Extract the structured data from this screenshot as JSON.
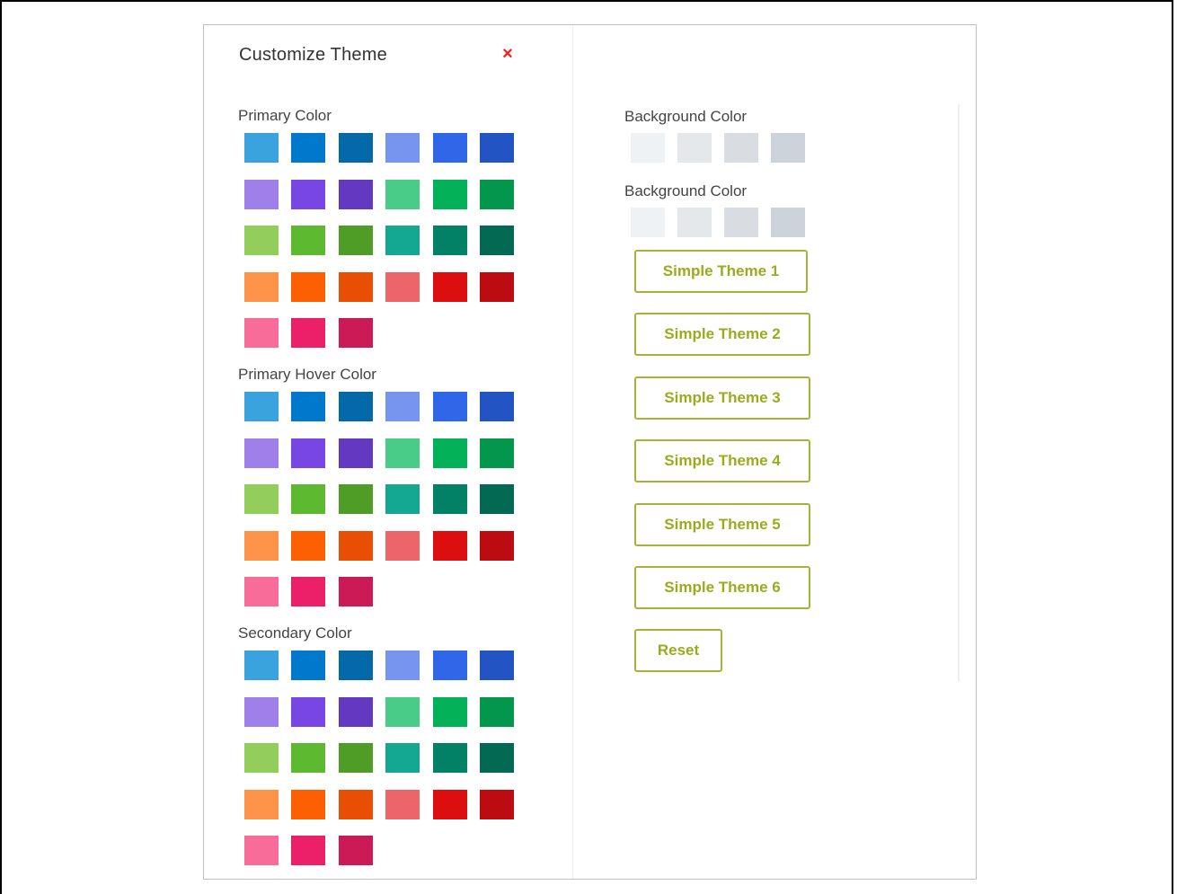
{
  "panel": {
    "title": "Customize Theme",
    "close_symbol": "×"
  },
  "palette": [
    "#3aa2dc",
    "#0078cc",
    "#0369a9",
    "#7695ef",
    "#2f67e8",
    "#2354c4",
    "#9f7fea",
    "#7847e3",
    "#6439c2",
    "#49cc88",
    "#03b158",
    "#02974c",
    "#93ce5d",
    "#5cb930",
    "#4f9d27",
    "#14a890",
    "#028166",
    "#026a53",
    "#fe944a",
    "#fc6003",
    "#e94f04",
    "#ec6669",
    "#dd0e10",
    "#bd0c11",
    "#f76c98",
    "#ec1f69",
    "#cc1a56"
  ],
  "sections": [
    {
      "label": "Primary Color"
    },
    {
      "label": "Primary Hover Color"
    },
    {
      "label": "Secondary Color"
    }
  ],
  "background": {
    "groups": [
      {
        "label": "Background Color"
      },
      {
        "label": "Background Color"
      }
    ],
    "colors": [
      "#eff2f5",
      "#e5e8eb",
      "#d9dde1",
      "#ccd3da"
    ]
  },
  "theme_buttons": [
    "Simple Theme 1",
    "Simple Theme 2",
    "Simple Theme 3",
    "Simple Theme 4",
    "Simple Theme 5",
    "Simple Theme 6"
  ],
  "reset_label": "Reset",
  "colors": {
    "accent": "#9aab1e",
    "close": "#ff1a1a"
  }
}
